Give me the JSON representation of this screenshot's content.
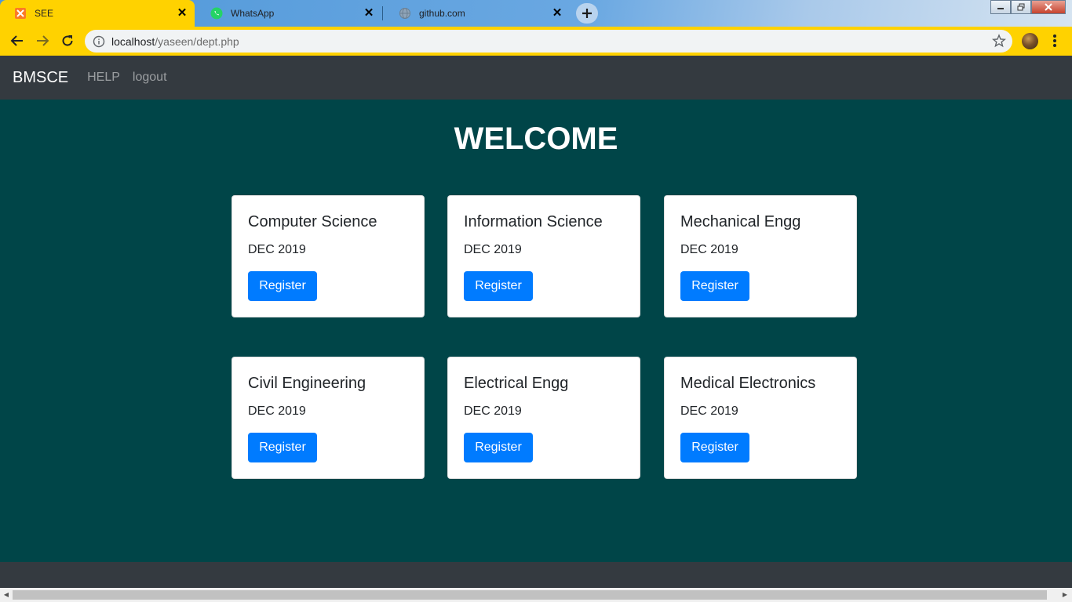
{
  "browser": {
    "tabs": [
      {
        "title": "SEE",
        "icon": "xampp-icon",
        "active": true
      },
      {
        "title": "WhatsApp",
        "icon": "whatsapp-icon",
        "active": false
      },
      {
        "title": "github.com",
        "icon": "globe-icon",
        "active": false
      }
    ],
    "address": {
      "host": "localhost",
      "path": "/yaseen/dept.php"
    },
    "accent_color": "#ffd200"
  },
  "navbar": {
    "brand": "BMSCE",
    "links": [
      "HELP",
      "logout"
    ]
  },
  "main": {
    "heading": "WELCOME",
    "background_color": "#004548",
    "departments": [
      {
        "name": "Computer Science",
        "date": "DEC 2019",
        "button": "Register"
      },
      {
        "name": "Information Science",
        "date": "DEC 2019",
        "button": "Register"
      },
      {
        "name": "Mechanical Engg",
        "date": "DEC 2019",
        "button": "Register"
      },
      {
        "name": "Civil Engineering",
        "date": "DEC 2019",
        "button": "Register"
      },
      {
        "name": "Electrical Engg",
        "date": "DEC 2019",
        "button": "Register"
      },
      {
        "name": "Medical Electronics",
        "date": "DEC 2019",
        "button": "Register"
      }
    ]
  }
}
